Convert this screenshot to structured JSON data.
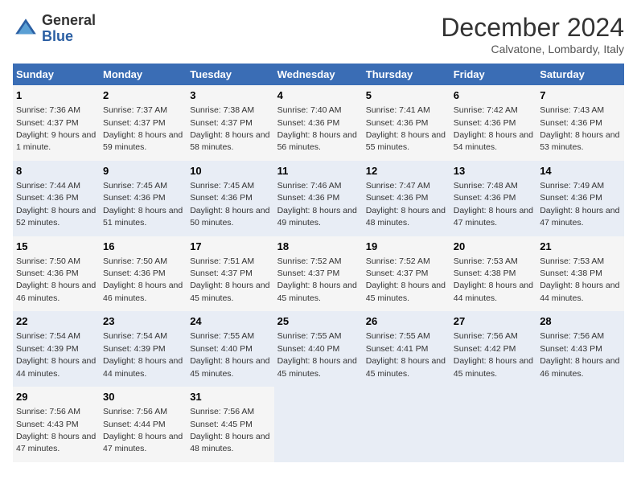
{
  "header": {
    "logo_line1": "General",
    "logo_line2": "Blue",
    "month_year": "December 2024",
    "location": "Calvatone, Lombardy, Italy"
  },
  "weekdays": [
    "Sunday",
    "Monday",
    "Tuesday",
    "Wednesday",
    "Thursday",
    "Friday",
    "Saturday"
  ],
  "weeks": [
    [
      {
        "day": "1",
        "sunrise": "Sunrise: 7:36 AM",
        "sunset": "Sunset: 4:37 PM",
        "daylight": "Daylight: 9 hours and 1 minute."
      },
      {
        "day": "2",
        "sunrise": "Sunrise: 7:37 AM",
        "sunset": "Sunset: 4:37 PM",
        "daylight": "Daylight: 8 hours and 59 minutes."
      },
      {
        "day": "3",
        "sunrise": "Sunrise: 7:38 AM",
        "sunset": "Sunset: 4:37 PM",
        "daylight": "Daylight: 8 hours and 58 minutes."
      },
      {
        "day": "4",
        "sunrise": "Sunrise: 7:40 AM",
        "sunset": "Sunset: 4:36 PM",
        "daylight": "Daylight: 8 hours and 56 minutes."
      },
      {
        "day": "5",
        "sunrise": "Sunrise: 7:41 AM",
        "sunset": "Sunset: 4:36 PM",
        "daylight": "Daylight: 8 hours and 55 minutes."
      },
      {
        "day": "6",
        "sunrise": "Sunrise: 7:42 AM",
        "sunset": "Sunset: 4:36 PM",
        "daylight": "Daylight: 8 hours and 54 minutes."
      },
      {
        "day": "7",
        "sunrise": "Sunrise: 7:43 AM",
        "sunset": "Sunset: 4:36 PM",
        "daylight": "Daylight: 8 hours and 53 minutes."
      }
    ],
    [
      {
        "day": "8",
        "sunrise": "Sunrise: 7:44 AM",
        "sunset": "Sunset: 4:36 PM",
        "daylight": "Daylight: 8 hours and 52 minutes."
      },
      {
        "day": "9",
        "sunrise": "Sunrise: 7:45 AM",
        "sunset": "Sunset: 4:36 PM",
        "daylight": "Daylight: 8 hours and 51 minutes."
      },
      {
        "day": "10",
        "sunrise": "Sunrise: 7:45 AM",
        "sunset": "Sunset: 4:36 PM",
        "daylight": "Daylight: 8 hours and 50 minutes."
      },
      {
        "day": "11",
        "sunrise": "Sunrise: 7:46 AM",
        "sunset": "Sunset: 4:36 PM",
        "daylight": "Daylight: 8 hours and 49 minutes."
      },
      {
        "day": "12",
        "sunrise": "Sunrise: 7:47 AM",
        "sunset": "Sunset: 4:36 PM",
        "daylight": "Daylight: 8 hours and 48 minutes."
      },
      {
        "day": "13",
        "sunrise": "Sunrise: 7:48 AM",
        "sunset": "Sunset: 4:36 PM",
        "daylight": "Daylight: 8 hours and 47 minutes."
      },
      {
        "day": "14",
        "sunrise": "Sunrise: 7:49 AM",
        "sunset": "Sunset: 4:36 PM",
        "daylight": "Daylight: 8 hours and 47 minutes."
      }
    ],
    [
      {
        "day": "15",
        "sunrise": "Sunrise: 7:50 AM",
        "sunset": "Sunset: 4:36 PM",
        "daylight": "Daylight: 8 hours and 46 minutes."
      },
      {
        "day": "16",
        "sunrise": "Sunrise: 7:50 AM",
        "sunset": "Sunset: 4:36 PM",
        "daylight": "Daylight: 8 hours and 46 minutes."
      },
      {
        "day": "17",
        "sunrise": "Sunrise: 7:51 AM",
        "sunset": "Sunset: 4:37 PM",
        "daylight": "Daylight: 8 hours and 45 minutes."
      },
      {
        "day": "18",
        "sunrise": "Sunrise: 7:52 AM",
        "sunset": "Sunset: 4:37 PM",
        "daylight": "Daylight: 8 hours and 45 minutes."
      },
      {
        "day": "19",
        "sunrise": "Sunrise: 7:52 AM",
        "sunset": "Sunset: 4:37 PM",
        "daylight": "Daylight: 8 hours and 45 minutes."
      },
      {
        "day": "20",
        "sunrise": "Sunrise: 7:53 AM",
        "sunset": "Sunset: 4:38 PM",
        "daylight": "Daylight: 8 hours and 44 minutes."
      },
      {
        "day": "21",
        "sunrise": "Sunrise: 7:53 AM",
        "sunset": "Sunset: 4:38 PM",
        "daylight": "Daylight: 8 hours and 44 minutes."
      }
    ],
    [
      {
        "day": "22",
        "sunrise": "Sunrise: 7:54 AM",
        "sunset": "Sunset: 4:39 PM",
        "daylight": "Daylight: 8 hours and 44 minutes."
      },
      {
        "day": "23",
        "sunrise": "Sunrise: 7:54 AM",
        "sunset": "Sunset: 4:39 PM",
        "daylight": "Daylight: 8 hours and 44 minutes."
      },
      {
        "day": "24",
        "sunrise": "Sunrise: 7:55 AM",
        "sunset": "Sunset: 4:40 PM",
        "daylight": "Daylight: 8 hours and 45 minutes."
      },
      {
        "day": "25",
        "sunrise": "Sunrise: 7:55 AM",
        "sunset": "Sunset: 4:40 PM",
        "daylight": "Daylight: 8 hours and 45 minutes."
      },
      {
        "day": "26",
        "sunrise": "Sunrise: 7:55 AM",
        "sunset": "Sunset: 4:41 PM",
        "daylight": "Daylight: 8 hours and 45 minutes."
      },
      {
        "day": "27",
        "sunrise": "Sunrise: 7:56 AM",
        "sunset": "Sunset: 4:42 PM",
        "daylight": "Daylight: 8 hours and 45 minutes."
      },
      {
        "day": "28",
        "sunrise": "Sunrise: 7:56 AM",
        "sunset": "Sunset: 4:43 PM",
        "daylight": "Daylight: 8 hours and 46 minutes."
      }
    ],
    [
      {
        "day": "29",
        "sunrise": "Sunrise: 7:56 AM",
        "sunset": "Sunset: 4:43 PM",
        "daylight": "Daylight: 8 hours and 47 minutes."
      },
      {
        "day": "30",
        "sunrise": "Sunrise: 7:56 AM",
        "sunset": "Sunset: 4:44 PM",
        "daylight": "Daylight: 8 hours and 47 minutes."
      },
      {
        "day": "31",
        "sunrise": "Sunrise: 7:56 AM",
        "sunset": "Sunset: 4:45 PM",
        "daylight": "Daylight: 8 hours and 48 minutes."
      },
      null,
      null,
      null,
      null
    ]
  ]
}
